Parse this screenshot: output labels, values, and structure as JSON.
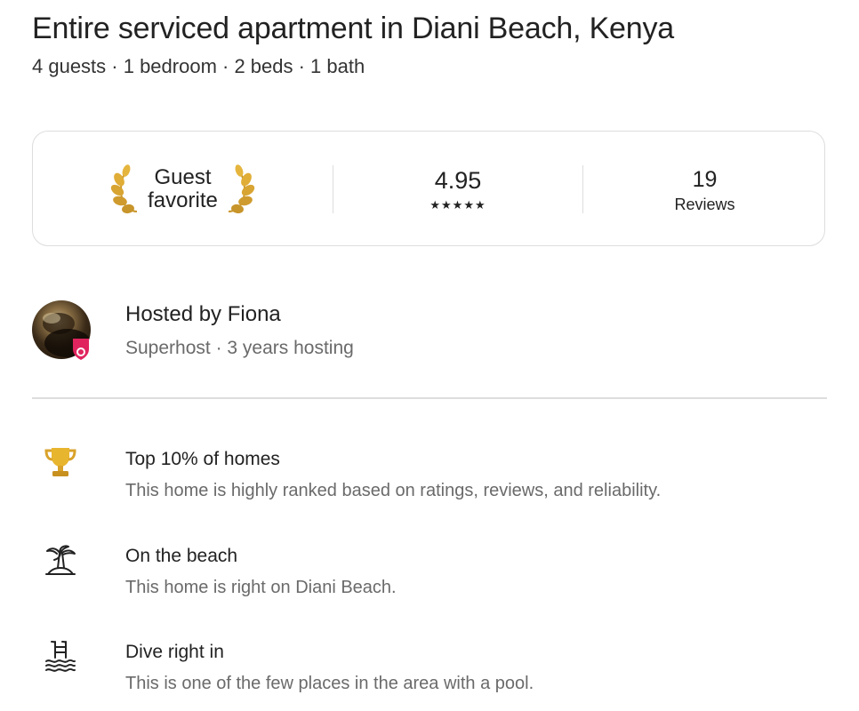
{
  "listing": {
    "title": "Entire serviced apartment in Diani Beach, Kenya",
    "subtitle": "4 guests · 1 bedroom · 2 beds · 1 bath"
  },
  "highlights_card": {
    "guest_favorite_line1": "Guest",
    "guest_favorite_line2": "favorite",
    "rating_value": "4.95",
    "stars": "★★★★★",
    "reviews_count": "19",
    "reviews_label": "Reviews",
    "laurel_icon": "gold-laurel-icon",
    "laurel_color": "#d9a832"
  },
  "host": {
    "name_line": "Hosted by Fiona",
    "details": "Superhost · 3 years hosting",
    "badge_color": "#e0245e"
  },
  "features": [
    {
      "icon": "trophy-icon",
      "title": "Top 10% of homes",
      "description": "This home is highly ranked based on ratings, reviews, and reliability."
    },
    {
      "icon": "palm-tree-beach-icon",
      "title": "On the beach",
      "description": "This home is right on Diani Beach."
    },
    {
      "icon": "pool-icon",
      "title": "Dive right in",
      "description": "This is one of the few places in the area with a pool."
    }
  ]
}
